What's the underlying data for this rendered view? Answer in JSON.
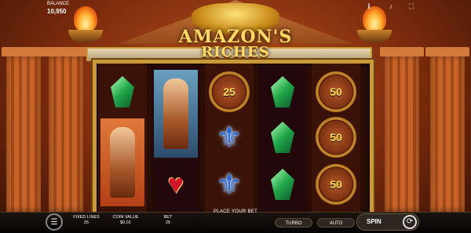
{
  "header": {
    "balance_label": "BALANCE",
    "balance_value": "10,950",
    "icons": [
      "info-icon",
      "sound-icon",
      "fullscreen-icon"
    ]
  },
  "logo": {
    "line1": "AMAZON'S",
    "line2": "RICHES"
  },
  "reels": [
    {
      "symbols": [
        "green-gem",
        "warrior-woman"
      ]
    },
    {
      "symbols": [
        "warrior-woman-blue",
        "red-heart"
      ]
    },
    {
      "symbols": [
        "shield-25",
        "blue-fleur",
        "blue-fleur"
      ],
      "shield_value": "25"
    },
    {
      "symbols": [
        "green-gem",
        "green-gem",
        "green-gem"
      ]
    },
    {
      "symbols": [
        "shield-50",
        "shield-50",
        "shield-50"
      ],
      "shield_value": "50"
    }
  ],
  "bottom_bar": {
    "message": "PLACE YOUR BET",
    "fixed_lines_label": "FIXED LINES",
    "fixed_lines_value": "25",
    "coin_value_label": "COIN VALUE",
    "coin_value_value": "$0.01",
    "bet_label": "BET",
    "bet_value": "25",
    "turbo_label": "TURBO",
    "auto_label": "AUTO",
    "spin_label": "SPIN"
  },
  "colors": {
    "frame_gold": "#c99a3a",
    "gem_green": "#22a84a",
    "fleur_blue": "#2b6ad8",
    "heart_red": "#d0142a"
  }
}
